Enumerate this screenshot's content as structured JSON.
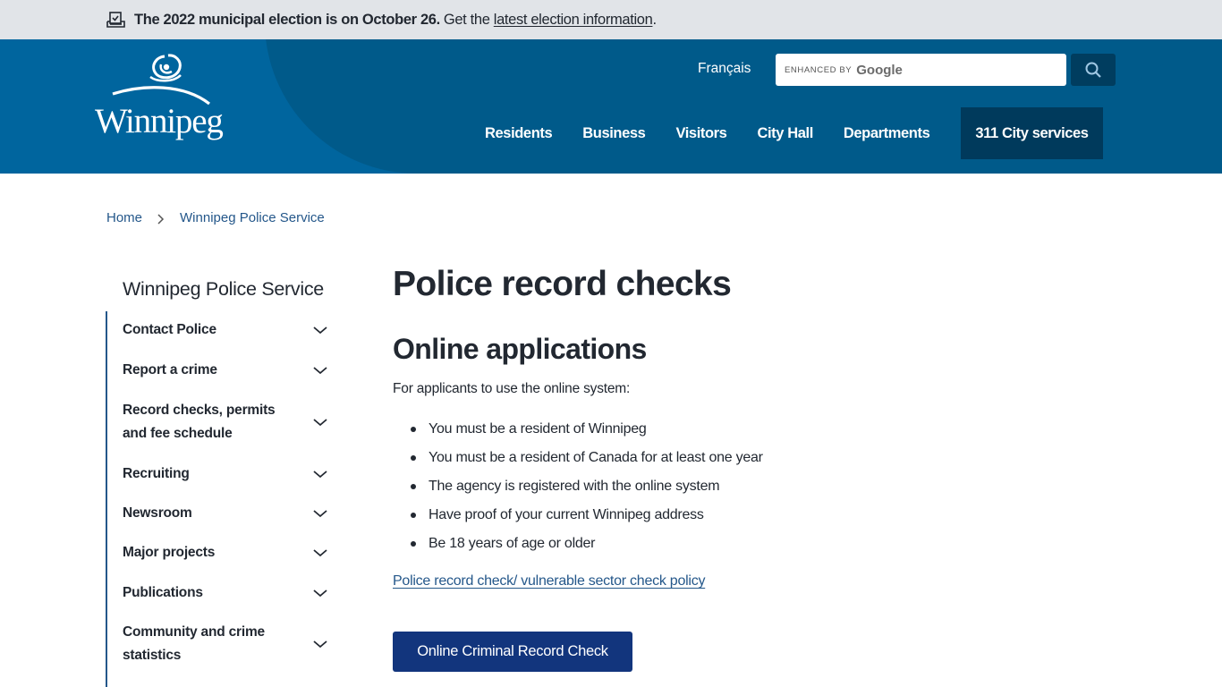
{
  "alert": {
    "icon": "ballot-box-icon",
    "bold_text": "The 2022 municipal election is on October 26.",
    "text_before_link": "Get the",
    "link_text": "latest election information",
    "text_after_link": "."
  },
  "header": {
    "logo_text": "Winnipeg",
    "language_link": "Français",
    "search": {
      "enhanced_label": "ENHANCED BY",
      "google_label": "Google",
      "value": "",
      "button_icon": "search-icon"
    },
    "nav": [
      {
        "label": "Residents"
      },
      {
        "label": "Business"
      },
      {
        "label": "Visitors"
      },
      {
        "label": "City Hall"
      },
      {
        "label": "Departments"
      }
    ],
    "cta_label": "311 City services"
  },
  "breadcrumb": [
    {
      "label": "Home"
    },
    {
      "label": "Winnipeg Police Service"
    }
  ],
  "sidebar": {
    "title": "Winnipeg Police Service",
    "items": [
      {
        "label": "Contact Police"
      },
      {
        "label": "Report a crime"
      },
      {
        "label": "Record checks, permits and fee schedule"
      },
      {
        "label": "Recruiting"
      },
      {
        "label": "Newsroom"
      },
      {
        "label": "Major projects"
      },
      {
        "label": "Publications"
      },
      {
        "label": "Community and crime statistics"
      }
    ]
  },
  "main": {
    "title": "Police record checks",
    "section_title": "Online applications",
    "intro": "For applicants to use the online system:",
    "requirements": [
      "You must be a resident of Winnipeg",
      "You must be a resident of Canada for at least one year",
      "The agency is registered with the online system",
      "Have proof of your current Winnipeg address",
      "Be 18 years of age or older"
    ],
    "policy_link": "Police record check/ vulnerable sector check policy",
    "button_label": "Online Criminal Record Check"
  },
  "colors": {
    "header_bg": "#00659e",
    "header_shape": "#005a8a",
    "cta_bg": "#003a5c",
    "alert_bg": "#e1e4e8",
    "link": "#24578a",
    "primary_button": "#12357d",
    "text": "#222831"
  }
}
